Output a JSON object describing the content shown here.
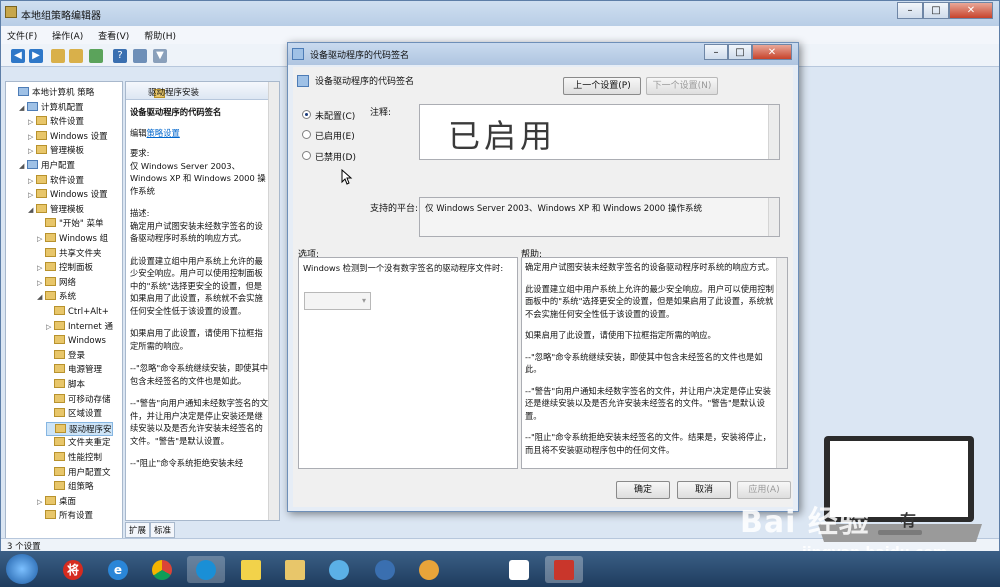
{
  "main_window": {
    "title": "本地组策略编辑器",
    "menu": [
      "文件(F)",
      "操作(A)",
      "查看(V)",
      "帮助(H)"
    ],
    "status": "3 个设置"
  },
  "tree": {
    "items": [
      {
        "label": "本地计算机 策略",
        "level": 0,
        "toggle": "",
        "icon": "pc"
      },
      {
        "label": "计算机配置",
        "level": 1,
        "toggle": "◢",
        "icon": "pc"
      },
      {
        "label": "软件设置",
        "level": 2,
        "toggle": "▷",
        "icon": "folder"
      },
      {
        "label": "Windows 设置",
        "level": 2,
        "toggle": "▷",
        "icon": "folder"
      },
      {
        "label": "管理模板",
        "level": 2,
        "toggle": "▷",
        "icon": "folder"
      },
      {
        "label": "用户配置",
        "level": 1,
        "toggle": "◢",
        "icon": "pc"
      },
      {
        "label": "软件设置",
        "level": 2,
        "toggle": "▷",
        "icon": "folder"
      },
      {
        "label": "Windows 设置",
        "level": 2,
        "toggle": "▷",
        "icon": "folder"
      },
      {
        "label": "管理模板",
        "level": 2,
        "toggle": "◢",
        "icon": "folder"
      },
      {
        "label": "\"开始\" 菜单",
        "level": 3,
        "toggle": "",
        "icon": "folder"
      },
      {
        "label": "Windows 组",
        "level": 3,
        "toggle": "▷",
        "icon": "folder"
      },
      {
        "label": "共享文件夹",
        "level": 3,
        "toggle": "",
        "icon": "folder"
      },
      {
        "label": "控制面板",
        "level": 3,
        "toggle": "▷",
        "icon": "folder"
      },
      {
        "label": "网络",
        "level": 3,
        "toggle": "▷",
        "icon": "folder"
      },
      {
        "label": "系统",
        "level": 3,
        "toggle": "◢",
        "icon": "folder"
      },
      {
        "label": "Ctrl+Alt+",
        "level": 4,
        "toggle": "",
        "icon": "folder"
      },
      {
        "label": "Internet 通",
        "level": 4,
        "toggle": "▷",
        "icon": "folder"
      },
      {
        "label": "Windows",
        "level": 4,
        "toggle": "",
        "icon": "folder"
      },
      {
        "label": "登录",
        "level": 4,
        "toggle": "",
        "icon": "folder"
      },
      {
        "label": "电源管理",
        "level": 4,
        "toggle": "",
        "icon": "folder"
      },
      {
        "label": "脚本",
        "level": 4,
        "toggle": "",
        "icon": "folder"
      },
      {
        "label": "可移动存储",
        "level": 4,
        "toggle": "",
        "icon": "folder"
      },
      {
        "label": "区域设置",
        "level": 4,
        "toggle": "",
        "icon": "folder"
      },
      {
        "label": "驱动程序安",
        "level": 4,
        "toggle": "",
        "icon": "folder",
        "selected": true
      },
      {
        "label": "文件夹重定",
        "level": 4,
        "toggle": "",
        "icon": "folder"
      },
      {
        "label": "性能控制",
        "level": 4,
        "toggle": "",
        "icon": "folder"
      },
      {
        "label": "用户配置文",
        "level": 4,
        "toggle": "",
        "icon": "folder"
      },
      {
        "label": "组策略",
        "level": 4,
        "toggle": "",
        "icon": "folder"
      },
      {
        "label": "桌面",
        "level": 3,
        "toggle": "▷",
        "icon": "folder"
      },
      {
        "label": "所有设置",
        "level": 3,
        "toggle": "",
        "icon": "folder"
      }
    ]
  },
  "desc_panel": {
    "header": "驱动程序安装",
    "title": "设备驱动程序的代码签名",
    "edit_prefix": "编辑",
    "edit_link": "策略设置",
    "req_label": "要求:",
    "req_text": "仅 Windows Server 2003、Windows XP 和 Windows 2000 操作系统",
    "desc_label": "描述:",
    "p1": "确定用户试图安装未经数字签名的设备驱动程序时系统的响应方式。",
    "p2": "此设置建立组中用户系统上允许的最少安全响应。用户可以使用控制面板中的\"系统\"选择更安全的设置，但是如果启用了此设置，系统就不会实施任何安全性低于该设置的设置。",
    "p3": "如果启用了此设置，请使用下拉框指定所需的响应。",
    "p4": "--\"忽略\"命令系统继续安装，即使其中包含未经签名的文件也是如此。",
    "p5": "--\"警告\"向用户通知未经数字签名的文件，并让用户决定是停止安装还是继续安装以及是否允许安装未经签名的文件。\"警告\"是默认设置。",
    "p6": "--\"阻止\"命令系统拒绝安装未经"
  },
  "tabs": [
    "扩展",
    "标准"
  ],
  "dialog": {
    "title": "设备驱动程序的代码签名",
    "heading": "设备驱动程序的代码签名",
    "prev_button": "上一个设置(P)",
    "next_button": "下一个设置(N)",
    "radios": [
      {
        "label": "未配置(C)",
        "checked": true
      },
      {
        "label": "已启用(E)",
        "checked": false
      },
      {
        "label": "已禁用(D)",
        "checked": false
      }
    ],
    "comment_label": "注释:",
    "comment_value": "已启用",
    "platform_label": "支持的平台:",
    "platform_value": "仅 Windows Server 2003、Windows XP 和 Windows 2000 操作系统",
    "options_label": "选项:",
    "help_label": "帮助:",
    "option_text": "Windows 检测到一个没有数字签名的驱动程序文件时:",
    "help": {
      "p1": "确定用户试图安装未经数字签名的设备驱动程序时系统的响应方式。",
      "p2": "此设置建立组中用户系统上允许的最少安全响应。用户可以使用控制面板中的\"系统\"选择更安全的设置，但是如果启用了此设置，系统就不会实施任何安全性低于该设置的设置。",
      "p3": "如果启用了此设置，请使用下拉框指定所需的响应。",
      "p4": "--\"忽略\"命令系统继续安装，即使其中包含未经签名的文件也是如此。",
      "p5": "--\"警告\"向用户通知未经数字签名的文件，并让用户决定是停止安装还是继续安装以及是否允许安装未经签名的文件。\"警告\"是默认设置。",
      "p6": "--\"阻止\"命令系统拒绝安装未经签名的文件。结果是，安装将停止，而且将不安装驱动程序包中的任何文件。"
    },
    "ok": "确定",
    "cancel": "取消",
    "apply": "应用(A)"
  },
  "taskbar": {
    "icons": [
      "start-icon",
      "jiang-icon",
      "ie-icon",
      "chrome-icon",
      "browser-icon",
      "sticky-notes-icon",
      "explorer-icon",
      "pinwheel-icon",
      "remote-icon",
      "paint-icon",
      "app-icon",
      "policy-editor-icon"
    ],
    "jiang_char": "将"
  },
  "watermark": {
    "brand": "Bai 经验",
    "url": "jingyan.baidu.com",
    "screen_text": "有"
  },
  "colors": {
    "accent": "#0066cc",
    "title_bar": "#c9daef",
    "taskbar": "#1e3c5e"
  }
}
